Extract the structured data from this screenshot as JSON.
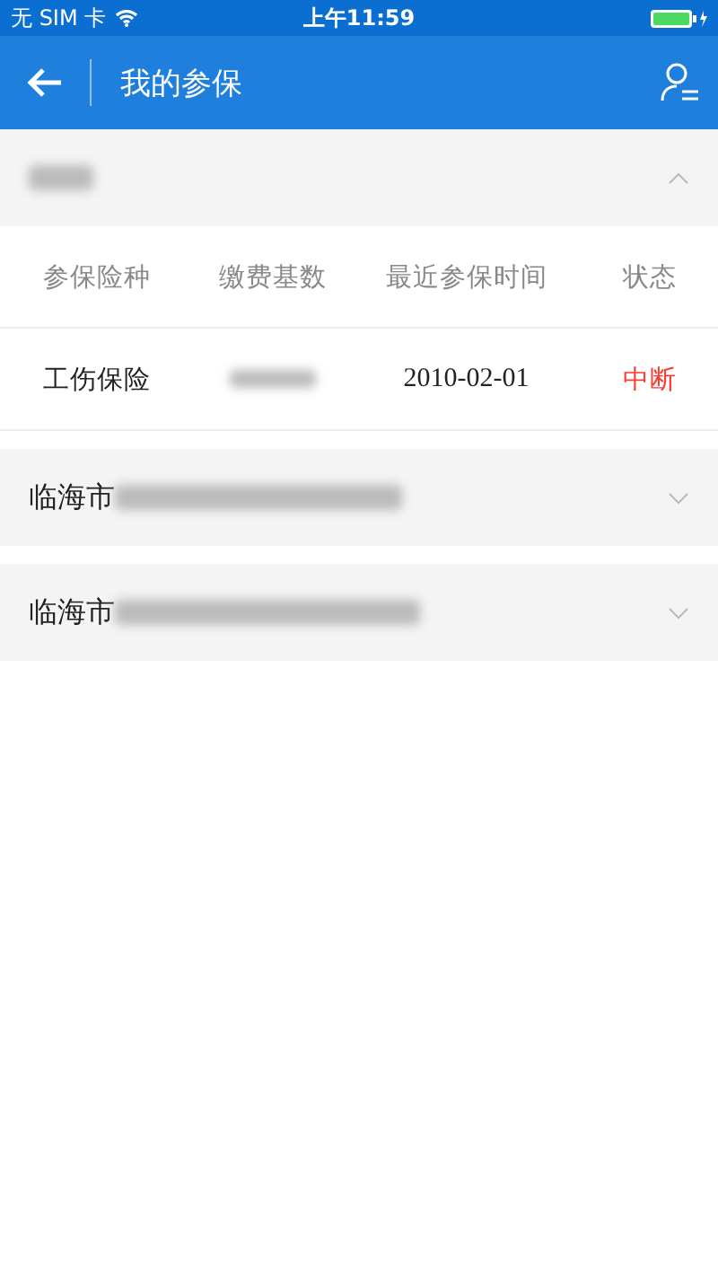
{
  "status_bar": {
    "carrier": "无 SIM 卡",
    "time": "上午11:59"
  },
  "nav_bar": {
    "title": "我的参保"
  },
  "sections": [
    {
      "expanded": true,
      "table": {
        "columns": [
          "参保险种",
          "缴费基数",
          "最近参保时间",
          "状态"
        ],
        "rows": [
          {
            "type": "工伤保险",
            "date": "2010-02-01",
            "status": "中断",
            "kind": "interrupted"
          }
        ]
      }
    },
    {
      "title": "临海市",
      "expanded": false
    },
    {
      "title": "临海市",
      "expanded": false
    }
  ]
}
